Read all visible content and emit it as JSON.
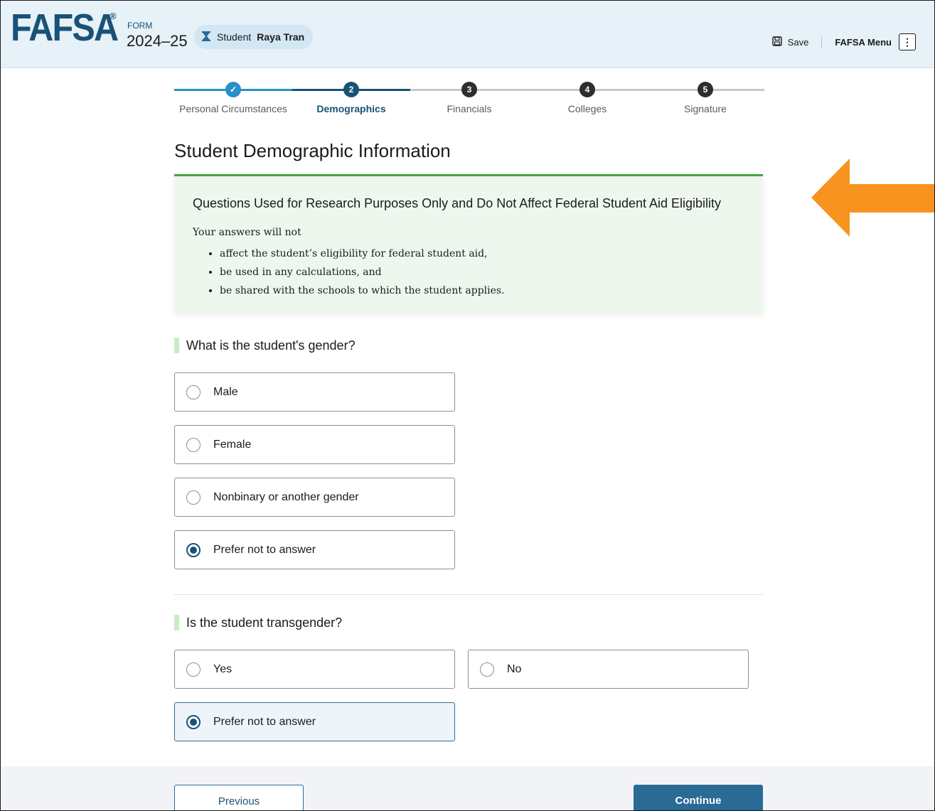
{
  "header": {
    "logo_text": "FAFSA",
    "registered_mark": "®",
    "form_label": "FORM",
    "form_year": "2024–25",
    "student_prefix": "Student",
    "student_name": "Raya Tran",
    "save_label": "Save",
    "menu_label": "FAFSA Menu",
    "menu_icon": "⋮"
  },
  "stepper": {
    "steps": [
      {
        "number": "✓",
        "label": "Personal Circumstances",
        "state": "complete"
      },
      {
        "number": "2",
        "label": "Demographics",
        "state": "current"
      },
      {
        "number": "3",
        "label": "Financials",
        "state": "upcoming"
      },
      {
        "number": "4",
        "label": "Colleges",
        "state": "upcoming"
      },
      {
        "number": "5",
        "label": "Signature",
        "state": "upcoming"
      }
    ]
  },
  "page": {
    "title": "Student Demographic Information"
  },
  "info_box": {
    "title": "Questions Used for Research Purposes Only and Do Not Affect Federal Student Aid Eligibility",
    "lead": "Your answers will not",
    "bullets": [
      "affect the student’s eligibility for federal student aid,",
      "be used in any calculations, and",
      "be shared with the schools to which the student applies."
    ]
  },
  "gender_question": {
    "label": "What is the student's gender?",
    "options": [
      "Male",
      "Female",
      "Nonbinary or another gender",
      "Prefer not to answer"
    ],
    "selected": "Prefer not to answer"
  },
  "transgender_question": {
    "label": "Is the student transgender?",
    "options": [
      "Yes",
      "No",
      "Prefer not to answer"
    ],
    "selected": "Prefer not to answer"
  },
  "footer": {
    "previous_label": "Previous",
    "continue_label": "Continue"
  },
  "colors": {
    "brand_blue": "#1a5276",
    "header_bg": "#e6f1f8",
    "success_green": "#3fa63f",
    "annotation_arrow": "#f7931e",
    "step_pending": "#2e2e2e"
  }
}
